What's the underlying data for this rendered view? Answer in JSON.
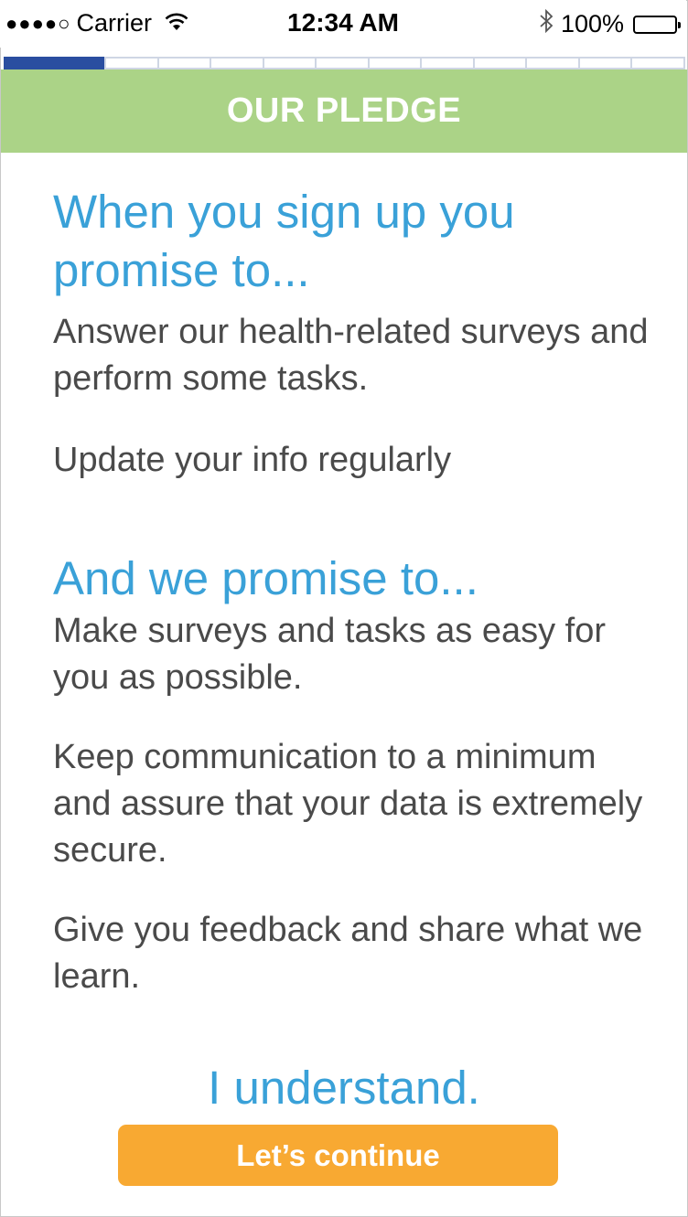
{
  "status_bar": {
    "signal_dots": "●●●●○",
    "carrier": "Carrier",
    "time": "12:34 AM",
    "battery": "100%"
  },
  "progress": {
    "segments_total": 13,
    "segments_done": 1
  },
  "header": {
    "title": "OUR PLEDGE"
  },
  "you_section": {
    "heading": "When you sign up you promise to...",
    "items": [
      "Answer our health-related surveys and perform some tasks.",
      "Update your info regularly"
    ]
  },
  "we_section": {
    "heading": "And we promise to...",
    "items": [
      "Make surveys and tasks as easy for you as possible.",
      "Keep communication to a minimum and assure that your data is extremely secure.",
      "Give you feedback and share what we learn."
    ]
  },
  "confirm_text": "I understand.",
  "continue_button": "Let’s continue",
  "colors": {
    "header_bg": "#abd387",
    "heading_blue": "#3aa1d8",
    "button_orange": "#f8a932",
    "progress_blue": "#2a4ea0"
  }
}
